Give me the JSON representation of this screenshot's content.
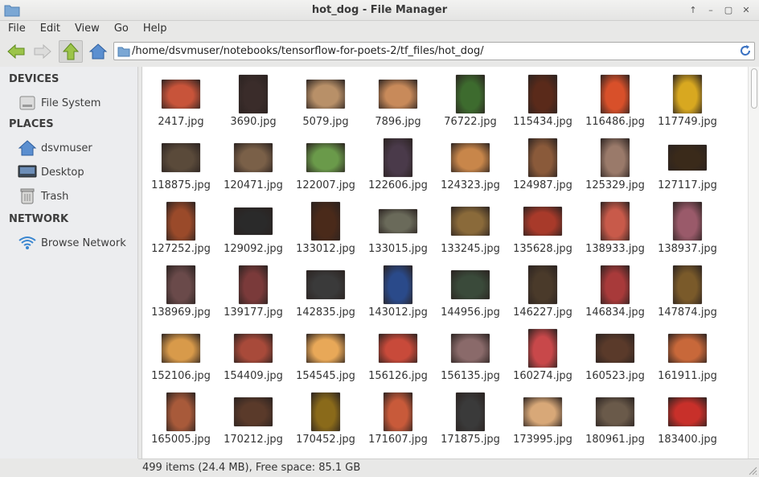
{
  "window": {
    "title": "hot_dog - File Manager",
    "buttons": [
      "↑",
      "–",
      "▢",
      "✕"
    ]
  },
  "menu": [
    "File",
    "Edit",
    "View",
    "Go",
    "Help"
  ],
  "toolbar": {
    "location": "/home/dsvmuser/notebooks/tensorflow-for-poets-2/tf_files/hot_dog/"
  },
  "sidebar": {
    "sections": [
      {
        "label": "DEVICES",
        "items": [
          {
            "label": "File System",
            "icon": "drive-icon"
          }
        ]
      },
      {
        "label": "PLACES",
        "items": [
          {
            "label": "dsvmuser",
            "icon": "home-icon"
          },
          {
            "label": "Desktop",
            "icon": "desktop-icon"
          },
          {
            "label": "Trash",
            "icon": "trash-icon"
          }
        ]
      },
      {
        "label": "NETWORK",
        "items": [
          {
            "label": "Browse Network",
            "icon": "network-icon"
          }
        ]
      }
    ]
  },
  "files": [
    "2417.jpg",
    "3690.jpg",
    "5079.jpg",
    "7896.jpg",
    "76722.jpg",
    "115434.jpg",
    "116486.jpg",
    "117749.jpg",
    "118875.jpg",
    "120471.jpg",
    "122007.jpg",
    "122606.jpg",
    "124323.jpg",
    "124987.jpg",
    "125329.jpg",
    "127117.jpg",
    "127252.jpg",
    "129092.jpg",
    "133012.jpg",
    "133015.jpg",
    "133245.jpg",
    "135628.jpg",
    "138933.jpg",
    "138937.jpg",
    "138969.jpg",
    "139177.jpg",
    "142835.jpg",
    "143012.jpg",
    "144956.jpg",
    "146227.jpg",
    "146834.jpg",
    "147874.jpg",
    "152106.jpg",
    "154409.jpg",
    "154545.jpg",
    "156126.jpg",
    "156135.jpg",
    "160274.jpg",
    "160523.jpg",
    "161911.jpg",
    "165005.jpg",
    "170212.jpg",
    "170452.jpg",
    "171607.jpg",
    "171875.jpg",
    "173995.jpg",
    "180961.jpg",
    "183400.jpg"
  ],
  "thumb_colors": [
    "#c8543a",
    "#3a2c2a",
    "#b89068",
    "#c88a5a",
    "#3d6b2e",
    "#5a2a1a",
    "#d8502a",
    "#d8a820",
    "#5a4a3a",
    "#7a6048",
    "#6a9a4a",
    "#4a3a4a",
    "#c8864a",
    "#8a5a3a",
    "#9a7a6a",
    "#3a2a1a",
    "#9a4a2a",
    "#2a2a2a",
    "#4a2a1a",
    "#6a6a5a",
    "#8a6a3a",
    "#a83a2a",
    "#c85a4a",
    "#9a5a6a",
    "#6a4a4a",
    "#7a3a3a",
    "#3a3a3a",
    "#2a4a8a",
    "#3a4a3a",
    "#4a3a2a",
    "#a83a3a",
    "#7a5a2a",
    "#d89a4a",
    "#a84a3a",
    "#e8a858",
    "#c84a3a",
    "#8a6a6a",
    "#c8484a",
    "#5a3a2a",
    "#c8683a",
    "#a85a3a",
    "#5a3a2a",
    "#8a6a1a",
    "#c85a3a",
    "#3a3a3a",
    "#d8a878",
    "#6a5a4a",
    "#c8302a"
  ],
  "status": {
    "text": "499 items (24.4 MB), Free space: 85.1 GB"
  }
}
